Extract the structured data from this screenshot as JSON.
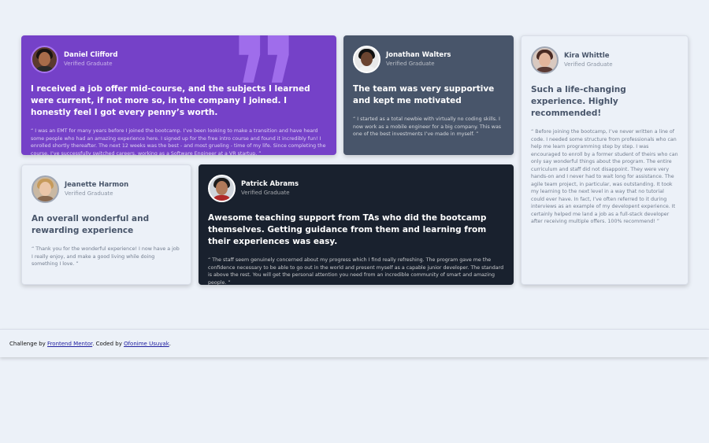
{
  "testimonials": [
    {
      "name": "Daniel Clifford",
      "role": "Verified Graduate",
      "headline": "I received a job offer mid-course, and the subjects I learned were current, if not more so, in the company I joined. I honestly feel I got every penny’s worth.",
      "body": "“ I was an EMT for many years before I joined the bootcamp. I’ve been looking to make a transition and have heard some people who had an amazing experience here. I signed up for the free intro course and found it incredibly fun! I enrolled shortly thereafter. The next 12 weeks was the best - and most grueling - time of my life. Since completing the course, I’ve successfully switched careers, working as a Software Engineer at a VR startup. ”"
    },
    {
      "name": "Jonathan Walters",
      "role": "Verified Graduate",
      "headline": "The team was very supportive and kept me motivated",
      "body": "“ I started as a total newbie with virtually no coding skills. I now work as a mobile engineer for a big company. This was one of the best investments I’ve made in myself. ”"
    },
    {
      "name": "Kira Whittle",
      "role": "Verified Graduate",
      "headline": "Such a life-changing experience. Highly recommended!",
      "body": "“ Before joining the bootcamp, I’ve never written a line of code. I needed some structure from professionals who can help me learn programming step by step. I was encouraged to enroll by a former student of theirs who can only say wonderful things about the program. The entire curriculum and staff did not disappoint. They were very hands-on and I never had to wait long for assistance. The agile team project, in particular, was outstanding. It took my learning to the next level in a way that no tutorial could ever have. In fact, I’ve often referred to it during interviews as an example of my developent experience. It certainly helped me land a job as a full-stack developer after receiving multiple offers. 100% recommend! ”"
    },
    {
      "name": "Jeanette Harmon",
      "role": "Verified Graduate",
      "headline": "An overall wonderful and rewarding experience",
      "body": "“ Thank you for the wonderful experience! I now have a job I really enjoy, and make a good living while doing something I love. ”"
    },
    {
      "name": "Patrick Abrams",
      "role": "Verified Graduate",
      "headline": "Awesome teaching support from TAs who did the bootcamp themselves. Getting guidance from them and learning from their experiences was easy.",
      "body": "“ The staff seem genuinely concerned about my progress which I find really refreshing. The program gave me the confidence necessary to be able to go out in the world and present myself as a capable junior developer. The standard is above the rest. You will get the personal attention you need from an incredible community of smart and amazing people. ”"
    }
  ],
  "footer": {
    "prefix": "Challenge by ",
    "link1": "Frontend Mentor",
    "middle": ". Coded by ",
    "link2": "Ofonime Usuyak",
    "suffix": "."
  },
  "colors": {
    "background": "#ecf1f8",
    "purple": "#7541c8",
    "grayblue": "#48556a",
    "dark": "#19212e"
  },
  "icons": {
    "quote": "quotation-mark-icon"
  }
}
